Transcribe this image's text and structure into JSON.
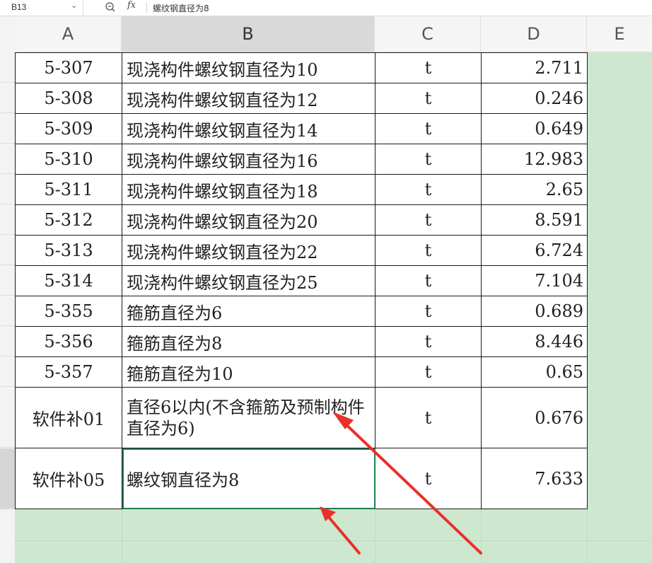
{
  "formula_bar": {
    "cell_ref": "B13",
    "dropdown_icon": "chevron-down-icon",
    "zoom_icon": "zoom-icon",
    "fx_label": "fx",
    "content": "螺纹钢直径为8"
  },
  "columns": [
    "A",
    "B",
    "C",
    "D",
    "E"
  ],
  "selected_column": "B",
  "rows": [
    {
      "a": "5-307",
      "b": "现浇构件螺纹钢直径为10",
      "c": "t",
      "d": "2.711"
    },
    {
      "a": "5-308",
      "b": "现浇构件螺纹钢直径为12",
      "c": "t",
      "d": "0.246"
    },
    {
      "a": "5-309",
      "b": "现浇构件螺纹钢直径为14",
      "c": "t",
      "d": "0.649"
    },
    {
      "a": "5-310",
      "b": "现浇构件螺纹钢直径为16",
      "c": "t",
      "d": "12.983"
    },
    {
      "a": "5-311",
      "b": "现浇构件螺纹钢直径为18",
      "c": "t",
      "d": "2.65"
    },
    {
      "a": "5-312",
      "b": "现浇构件螺纹钢直径为20",
      "c": "t",
      "d": "8.591"
    },
    {
      "a": "5-313",
      "b": "现浇构件螺纹钢直径为22",
      "c": "t",
      "d": "6.724"
    },
    {
      "a": "5-314",
      "b": "现浇构件螺纹钢直径为25",
      "c": "t",
      "d": "7.104"
    },
    {
      "a": "5-355",
      "b": "箍筋直径为6",
      "c": "t",
      "d": "0.689"
    },
    {
      "a": "5-356",
      "b": "箍筋直径为8",
      "c": "t",
      "d": "8.446"
    },
    {
      "a": "5-357",
      "b": "箍筋直径为10",
      "c": "t",
      "d": "0.65"
    },
    {
      "a": "软件补01",
      "b": "直径6以内(不含箍筋及预制构件直径为6)",
      "c": "t",
      "d": "0.676"
    },
    {
      "a": "软件补05",
      "b": "螺纹钢直径为8",
      "c": "t",
      "d": "7.633"
    }
  ],
  "colors": {
    "selection_green": "#1e7e4e",
    "fill_green": "#cde8cf",
    "arrow_red": "#e8312a"
  }
}
